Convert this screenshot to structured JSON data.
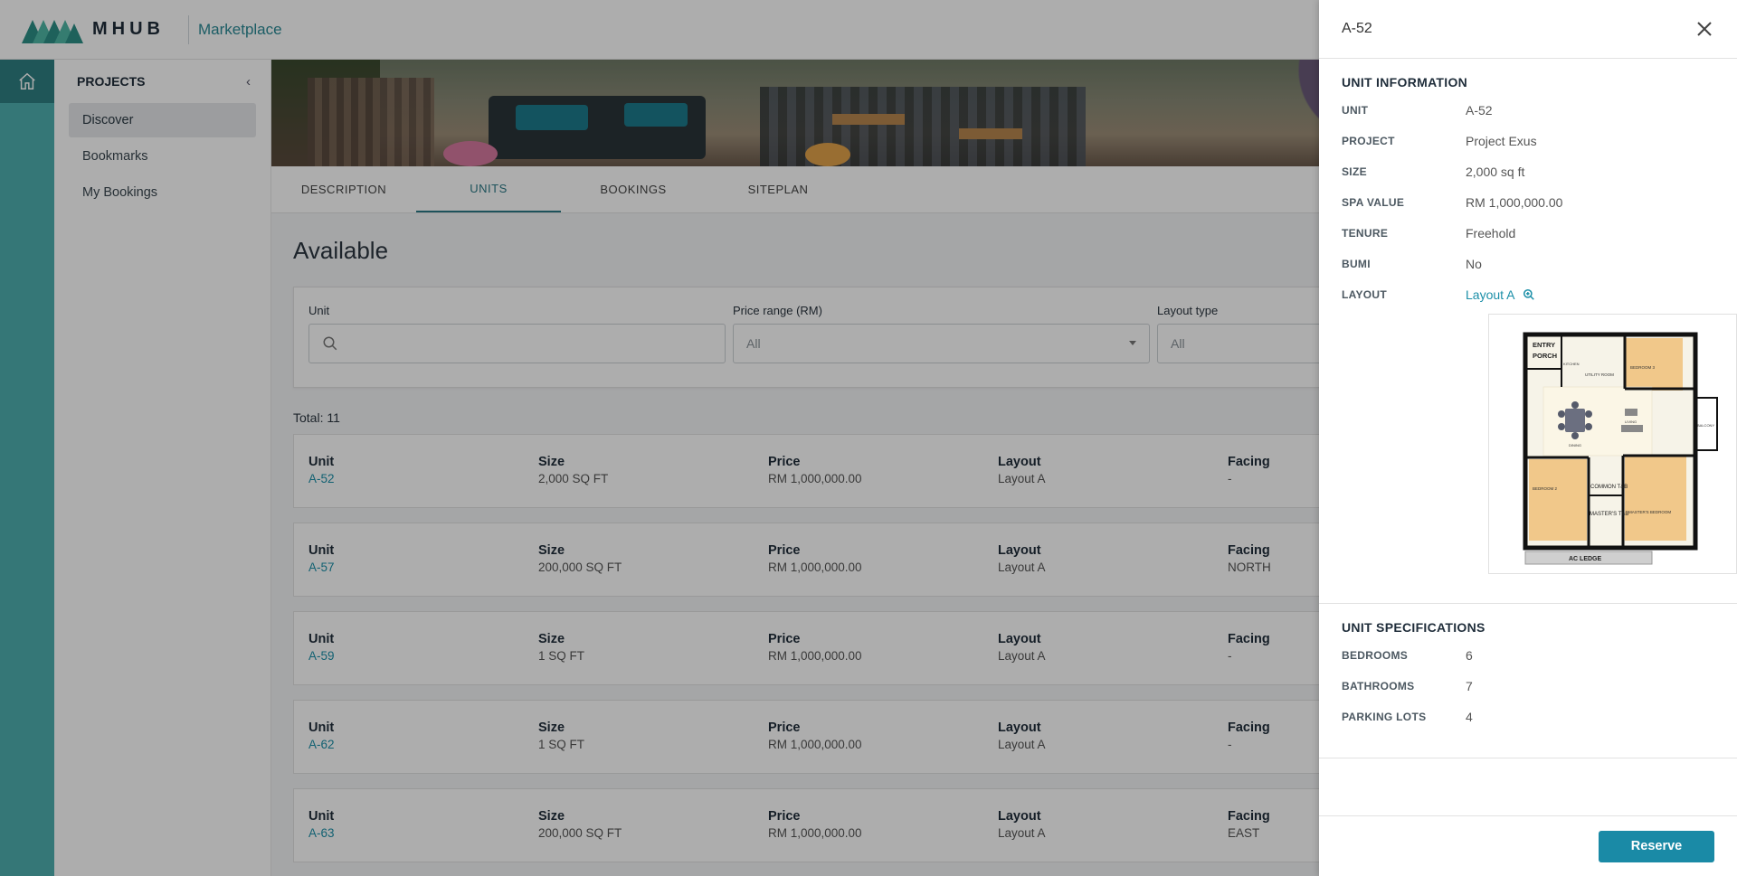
{
  "header": {
    "logo_text": "MHUB",
    "app_name": "Marketplace"
  },
  "sidebar": {
    "title": "PROJECTS",
    "items": [
      {
        "label": "Discover",
        "active": true
      },
      {
        "label": "Bookmarks",
        "active": false
      },
      {
        "label": "My Bookings",
        "active": false
      }
    ]
  },
  "tabs": [
    {
      "label": "DESCRIPTION",
      "active": false
    },
    {
      "label": "UNITS",
      "active": true
    },
    {
      "label": "BOOKINGS",
      "active": false
    },
    {
      "label": "SITEPLAN",
      "active": false
    }
  ],
  "main": {
    "heading": "Available",
    "filters": {
      "unit_label": "Unit",
      "unit_placeholder": "",
      "price_label": "Price range (RM)",
      "price_value": "All",
      "layout_label": "Layout type",
      "layout_value": "All"
    },
    "total": "Total: 11",
    "columns": {
      "unit": "Unit",
      "size": "Size",
      "price": "Price",
      "layout": "Layout",
      "facing": "Facing"
    },
    "units": [
      {
        "unit": "A-52",
        "size": "2,000 SQ FT",
        "price": "RM 1,000,000.00",
        "layout": "Layout A",
        "facing": "-"
      },
      {
        "unit": "A-57",
        "size": "200,000 SQ FT",
        "price": "RM 1,000,000.00",
        "layout": "Layout A",
        "facing": "NORTH"
      },
      {
        "unit": "A-59",
        "size": "1 SQ FT",
        "price": "RM 1,000,000.00",
        "layout": "Layout A",
        "facing": "-"
      },
      {
        "unit": "A-62",
        "size": "1 SQ FT",
        "price": "RM 1,000,000.00",
        "layout": "Layout A",
        "facing": "-"
      },
      {
        "unit": "A-63",
        "size": "200,000 SQ FT",
        "price": "RM 1,000,000.00",
        "layout": "Layout A",
        "facing": "EAST"
      }
    ]
  },
  "drawer": {
    "title": "A-52",
    "unit_info": {
      "title": "UNIT INFORMATION",
      "rows": [
        {
          "key": "UNIT",
          "value": "A-52"
        },
        {
          "key": "PROJECT",
          "value": "Project Exus"
        },
        {
          "key": "SIZE",
          "value": "2,000 sq ft"
        },
        {
          "key": "SPA VALUE",
          "value": "RM 1,000,000.00"
        },
        {
          "key": "TENURE",
          "value": "Freehold"
        },
        {
          "key": "BUMI",
          "value": "No"
        }
      ],
      "layout_key": "LAYOUT",
      "layout_value": "Layout A"
    },
    "floorplan_labels": {
      "entry": "ENTRY",
      "porch": "PORCH",
      "kitchen": "KITCHEN",
      "utility": "UTILITY ROOM",
      "bedroom3": "BEDROOM 3",
      "dining": "DINING",
      "living": "LIVING",
      "balcony": "BALCONY",
      "bedroom2": "BEDROOM 2",
      "common": "COMMON T&B",
      "master_tb": "MASTER'S T&B",
      "master_bed": "MASTER'S BEDROOM",
      "ac_ledge": "AC LEDGE"
    },
    "unit_specs": {
      "title": "UNIT SPECIFICATIONS",
      "rows": [
        {
          "key": "BEDROOMS",
          "value": "6"
        },
        {
          "key": "BATHROOMS",
          "value": "7"
        },
        {
          "key": "PARKING LOTS",
          "value": "4"
        }
      ]
    },
    "reserve_label": "Reserve"
  },
  "colors": {
    "accent": "#1a8aa6",
    "rail": "#4fb0b0",
    "rail_active": "#2f7f82",
    "link": "#1b8fa8"
  },
  "icons": [
    "home-icon",
    "chevron-left-icon",
    "search-icon",
    "chevron-down-icon",
    "close-icon",
    "zoom-in-icon"
  ]
}
